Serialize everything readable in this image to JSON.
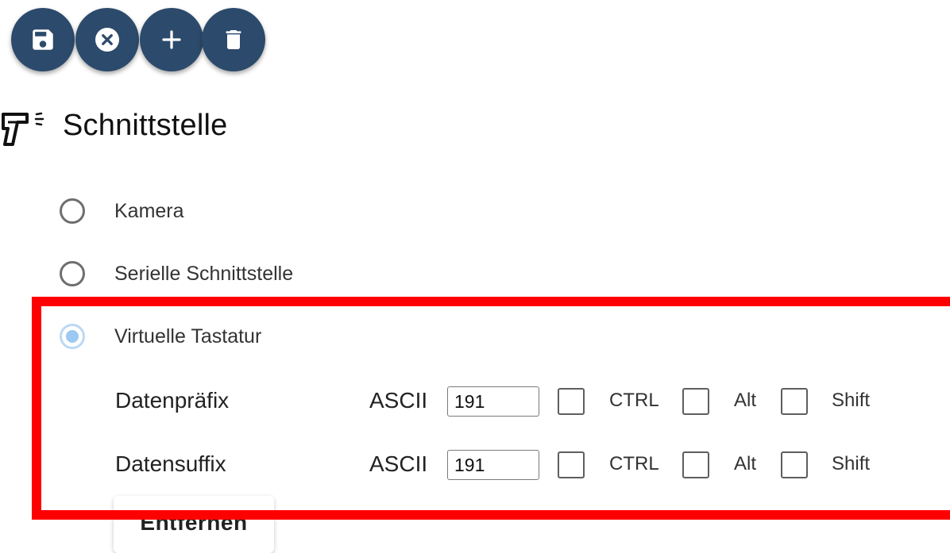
{
  "toolbar": {
    "buttons": [
      {
        "icon": "save-icon"
      },
      {
        "icon": "cancel-icon"
      },
      {
        "icon": "plus-icon"
      },
      {
        "icon": "trash-icon"
      }
    ],
    "accent_color": "#2c4a6b"
  },
  "section": {
    "title": "Schnittstelle",
    "icon": "barcode-scanner-icon"
  },
  "interface_options": [
    {
      "label": "Kamera",
      "selected": false
    },
    {
      "label": "Serielle Schnittstelle",
      "selected": false
    },
    {
      "label": "Virtuelle Tastatur",
      "selected": true
    }
  ],
  "keyboard": {
    "prefix": {
      "label": "Datenpräfix",
      "ascii_label": "ASCII",
      "ascii_value": "191",
      "modifiers": [
        {
          "label": "CTRL",
          "checked": false
        },
        {
          "label": "Alt",
          "checked": false
        },
        {
          "label": "Shift",
          "checked": false
        }
      ]
    },
    "suffix": {
      "label": "Datensuffix",
      "ascii_label": "ASCII",
      "ascii_value": "191",
      "modifiers": [
        {
          "label": "CTRL",
          "checked": false
        },
        {
          "label": "Alt",
          "checked": false
        },
        {
          "label": "Shift",
          "checked": false
        }
      ]
    }
  },
  "remove_button": {
    "label": "Entfernen"
  },
  "highlight_color": "#ff0000"
}
